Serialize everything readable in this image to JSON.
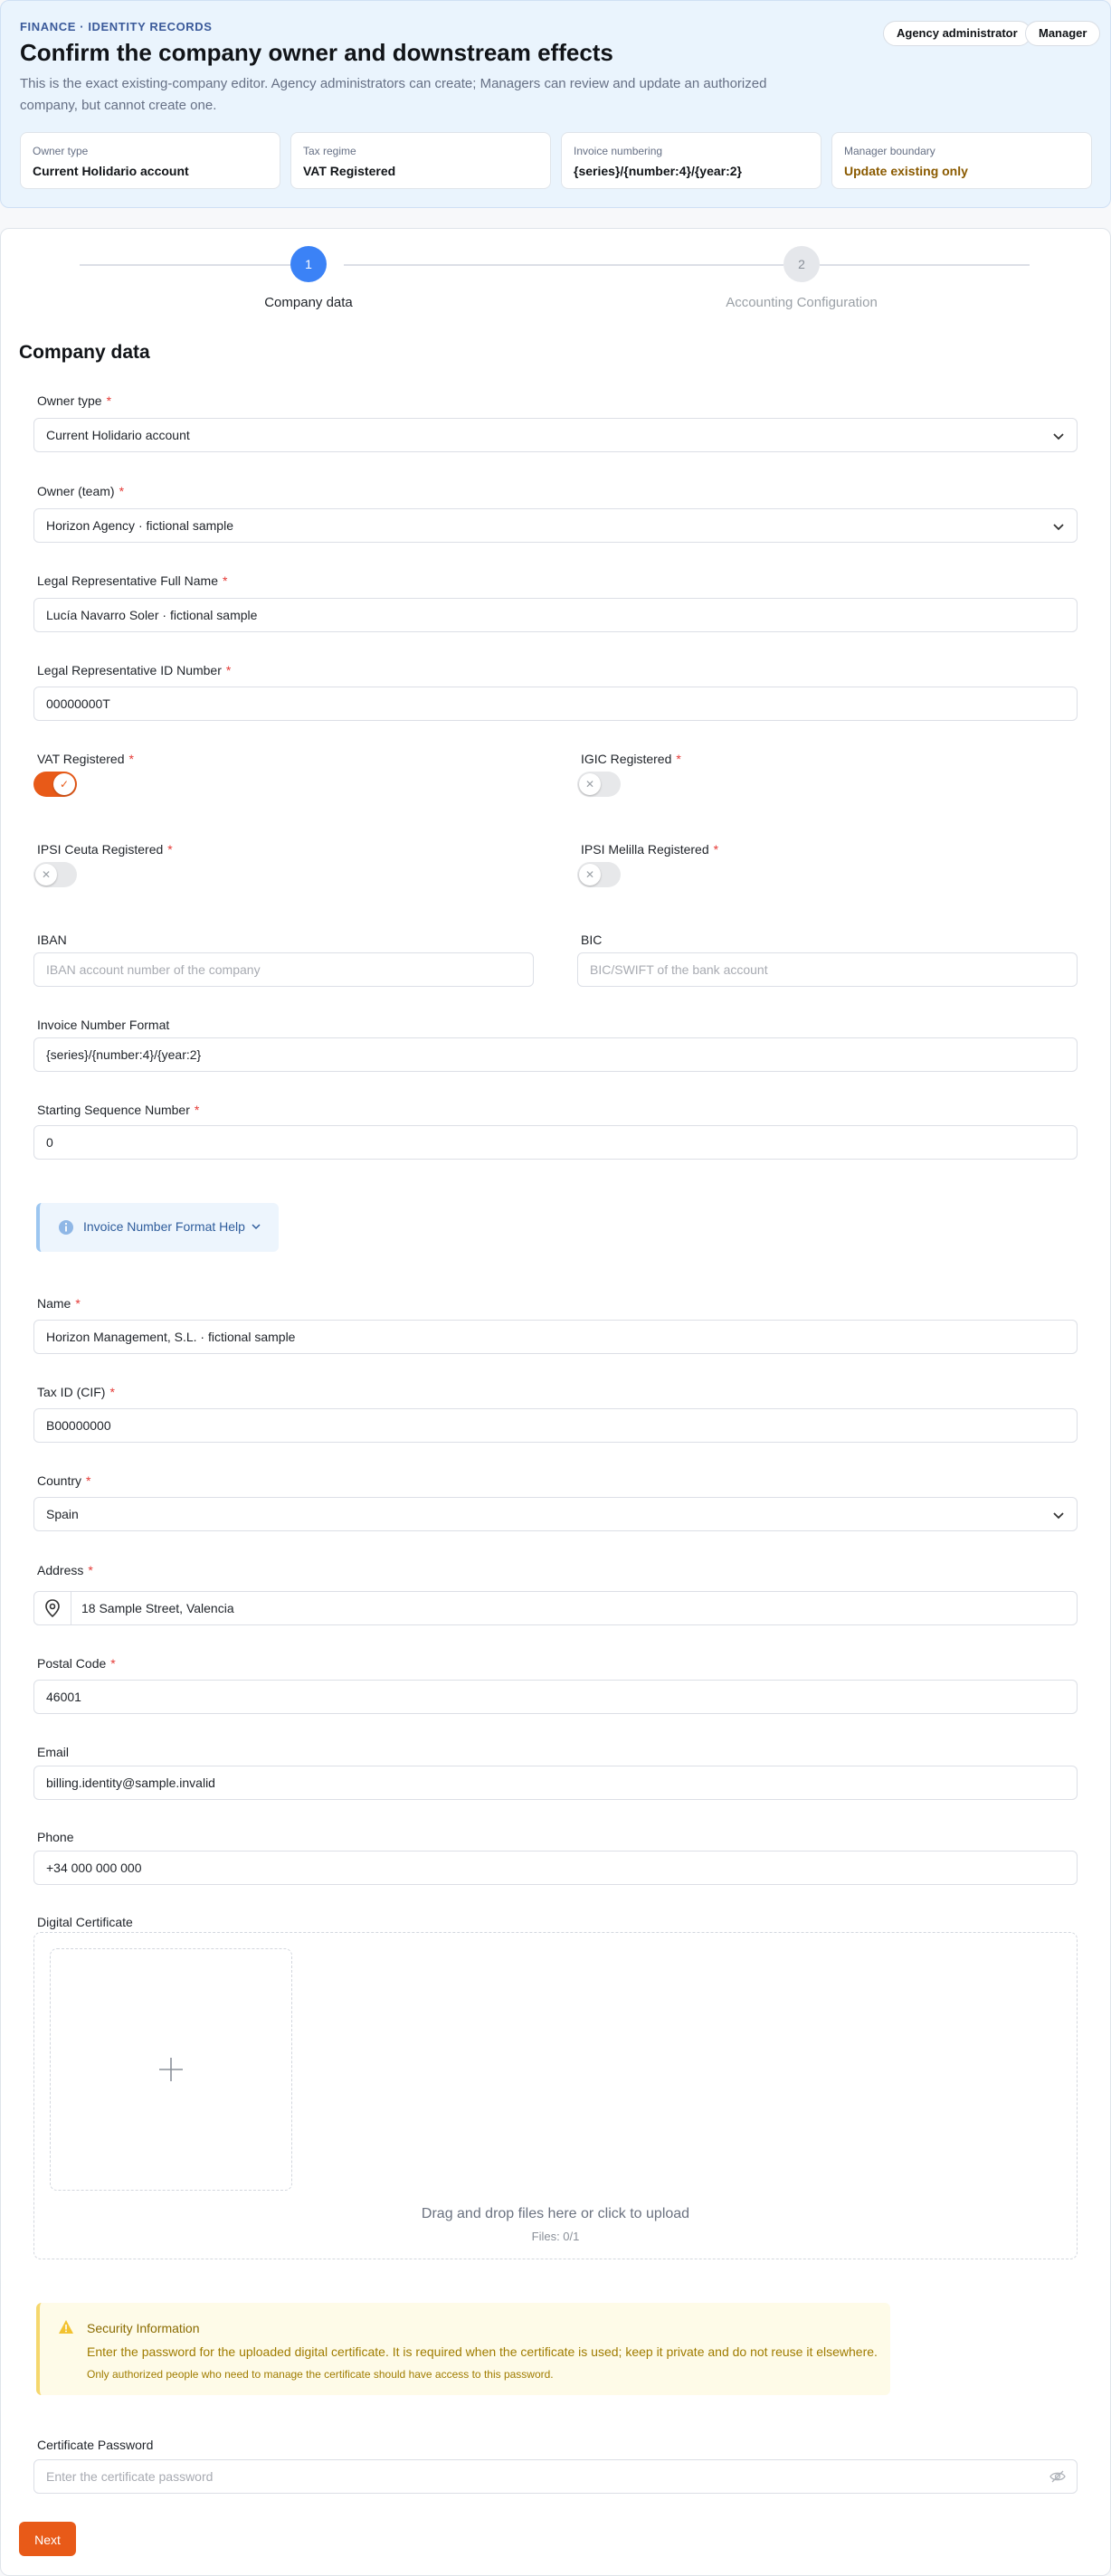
{
  "header": {
    "eyebrow": "FINANCE · IDENTITY RECORDS",
    "title": "Confirm the company owner and downstream effects",
    "description": "This is the exact existing-company editor. Agency administrators can create; Managers can review and update an authorized company, but cannot create one.",
    "roles": [
      "Agency administrator",
      "Manager"
    ],
    "summary": [
      {
        "label": "Owner type",
        "value": "Current Holidario account"
      },
      {
        "label": "Tax regime",
        "value": "VAT Registered"
      },
      {
        "label": "Invoice numbering",
        "value": "{series}/{number:4}/{year:2}"
      },
      {
        "label": "Manager boundary",
        "value": "Update existing only"
      }
    ]
  },
  "stepper": {
    "steps": [
      {
        "number": "1",
        "label": "Company data",
        "state": "active"
      },
      {
        "number": "2",
        "label": "Accounting Configuration",
        "state": "inactive"
      }
    ]
  },
  "form": {
    "section_title": "Company data",
    "owner_type": {
      "label": "Owner type",
      "value": "Current Holidario account"
    },
    "owner_team": {
      "label": "Owner (team)",
      "value": "Horizon Agency · fictional sample"
    },
    "legal_rep_name": {
      "label": "Legal Representative Full Name",
      "value": "Lucía Navarro Soler · fictional sample"
    },
    "legal_rep_id": {
      "label": "Legal Representative ID Number",
      "value": "00000000T"
    },
    "vat": {
      "label": "VAT Registered",
      "on": true
    },
    "igic": {
      "label": "IGIC Registered",
      "on": false
    },
    "ipsi_ceuta": {
      "label": "IPSI Ceuta Registered",
      "on": false
    },
    "ipsi_melilla": {
      "label": "IPSI Melilla Registered",
      "on": false
    },
    "iban": {
      "label": "IBAN",
      "placeholder": "IBAN account number of the company"
    },
    "bic": {
      "label": "BIC",
      "placeholder": "BIC/SWIFT of the bank account"
    },
    "invoice_format": {
      "label": "Invoice Number Format",
      "value": "{series}/{number:4}/{year:2}"
    },
    "starting_sequence": {
      "label": "Starting Sequence Number",
      "value": "0"
    },
    "help_link": "Invoice Number Format Help",
    "name": {
      "label": "Name",
      "value": "Horizon Management, S.L. · fictional sample"
    },
    "tax_id": {
      "label": "Tax ID (CIF)",
      "value": "B00000000"
    },
    "country": {
      "label": "Country",
      "value": "Spain"
    },
    "address": {
      "label": "Address",
      "value": "18 Sample Street, Valencia"
    },
    "postal_code": {
      "label": "Postal Code",
      "value": "46001"
    },
    "email": {
      "label": "Email",
      "value": "billing.identity@sample.invalid"
    },
    "phone": {
      "label": "Phone",
      "value": "+34 000 000 000"
    },
    "certificate": {
      "label": "Digital Certificate",
      "hint": "Drag and drop files here or click to upload",
      "count": "Files: 0/1"
    },
    "security": {
      "title": "Security Information",
      "body": "Enter the password for the uploaded digital certificate. It is required when the certificate is used; keep it private and do not reuse it elsewhere.",
      "note": "Only authorized people who need to manage the certificate should have access to this password."
    },
    "cert_password": {
      "label": "Certificate Password",
      "placeholder": "Enter the certificate password"
    },
    "next_label": "Next",
    "required_mark": "*"
  },
  "colors": {
    "accent": "#e85a18",
    "primary": "#3b82f6",
    "required": "#e53935"
  },
  "icons": [
    "chevron-down-icon",
    "info-icon",
    "location-pin-icon",
    "plus-icon",
    "warning-icon",
    "eye-off-icon",
    "check-icon",
    "close-icon"
  ]
}
